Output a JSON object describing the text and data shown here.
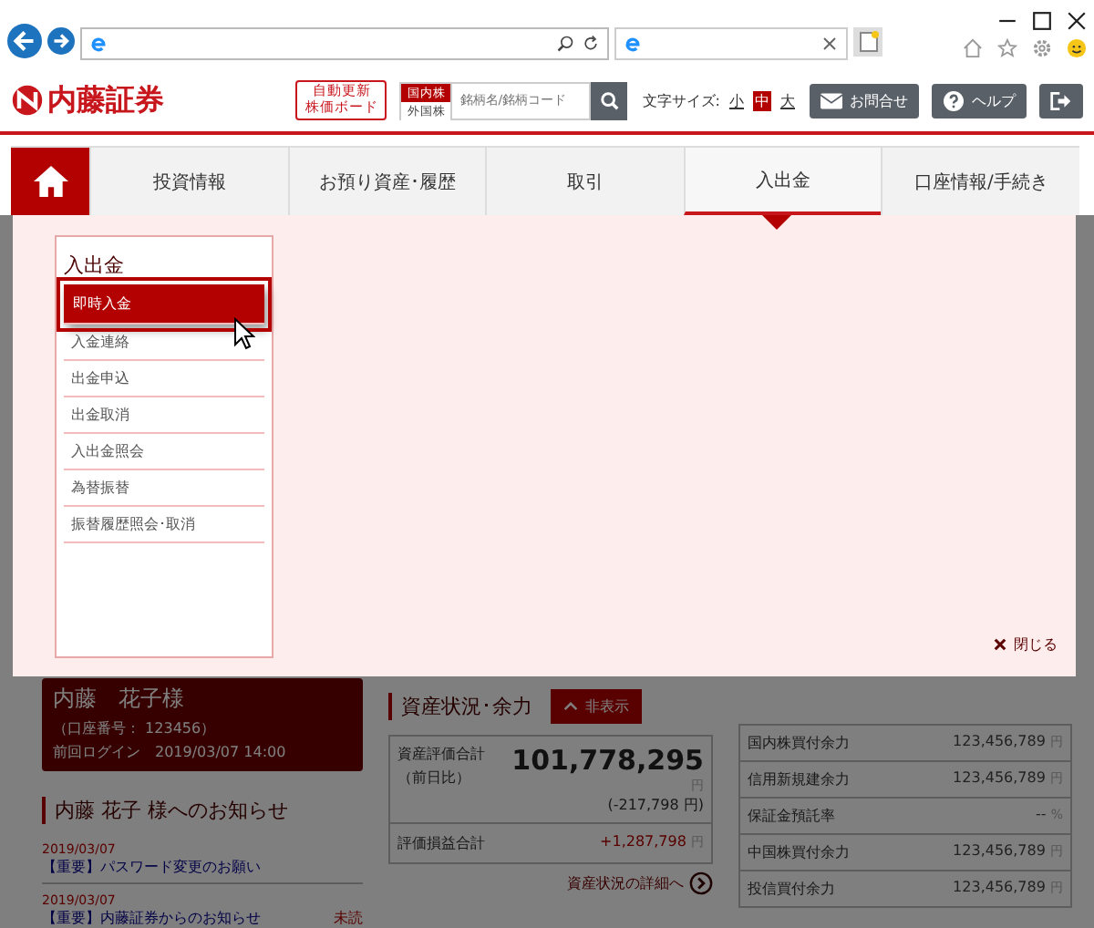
{
  "header": {
    "logo": "内藤証券",
    "board_button": [
      "自動更新",
      "株価ボード"
    ],
    "market_tabs": [
      {
        "label": "国内株",
        "selected": true
      },
      {
        "label": "外国株",
        "selected": false
      }
    ],
    "search": {
      "placeholder": "銘柄名/銘柄コード"
    },
    "font_size": {
      "label": "文字サイズ:",
      "options": [
        {
          "label": "小",
          "selected": false
        },
        {
          "label": "中",
          "selected": true
        },
        {
          "label": "大",
          "selected": false
        }
      ]
    },
    "buttons": [
      {
        "kind": "mail",
        "label": "お問合せ"
      },
      {
        "kind": "help",
        "label": "ヘルプ"
      },
      {
        "kind": "logout"
      }
    ]
  },
  "nav": [
    {
      "label": "投資情報",
      "selected": false
    },
    {
      "label": "お預り資産･履歴",
      "selected": false
    },
    {
      "label": "取引",
      "selected": false
    },
    {
      "label": "入出金",
      "selected": true
    },
    {
      "label": "口座情報/手続き",
      "selected": false
    }
  ],
  "menu": {
    "title": "入出金",
    "items": [
      {
        "label": "即時入金",
        "selected": true
      },
      {
        "label": "入金連絡",
        "selected": false
      },
      {
        "label": "出金申込",
        "selected": false
      },
      {
        "label": "出金取消",
        "selected": false
      },
      {
        "label": "入出金照会",
        "selected": false
      },
      {
        "label": "為替振替",
        "selected": false
      },
      {
        "label": "振替履歴照会･取消",
        "selected": false
      }
    ],
    "close": "閉じる"
  },
  "account": {
    "name": "内藤　花子様",
    "number": "（口座番号： 123456）",
    "last_login": "前回ログイン　2019/03/07 14:00"
  },
  "notices": {
    "title": "内藤 花子 様へのお知らせ",
    "items": [
      {
        "date": "2019/03/07",
        "text": "【重要】パスワード変更のお願い"
      },
      {
        "date": "2019/03/07",
        "text": "【重要】内藤証券からのお知らせ",
        "badge": "未読"
      }
    ]
  },
  "assets": {
    "title": "資産状況･余力",
    "toggle": "非表示",
    "total_label": "資産評価合計",
    "total_sub": "（前日比）",
    "total": "101,778,295",
    "total_unit": "円",
    "change": "(-217,798 円)",
    "pl_label": "評価損益合計",
    "pl": "+1,287,798",
    "pl_unit": "円",
    "detail_link": "資産状況の詳細へ"
  },
  "capacity": [
    {
      "label": "国内株買付余力",
      "value": "123,456,789",
      "unit": "円"
    },
    {
      "label": "信用新規建余力",
      "value": "123,456,789",
      "unit": "円"
    },
    {
      "label": "保証金預託率",
      "value": "--",
      "unit": "%"
    },
    {
      "label": "中国株買付余力",
      "value": "123,456,789",
      "unit": "円"
    },
    {
      "label": "投信買付余力",
      "value": "123,456,789",
      "unit": "円"
    }
  ]
}
